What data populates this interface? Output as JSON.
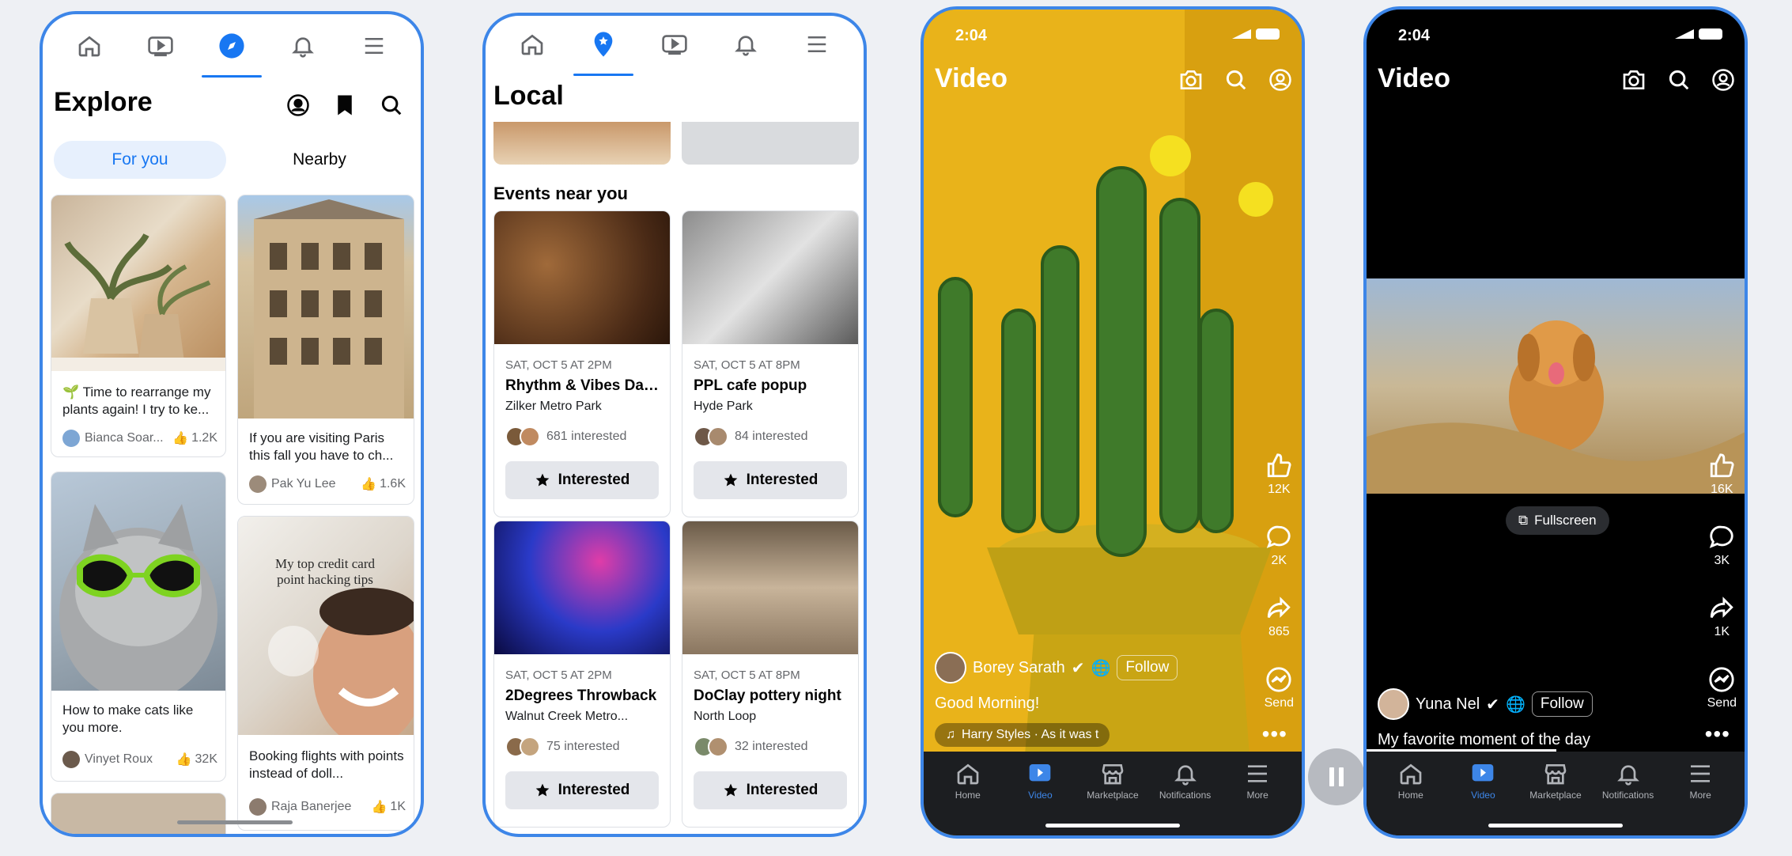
{
  "explore": {
    "title": "Explore",
    "tabs": [
      "For you",
      "Nearby"
    ],
    "cards": [
      {
        "text": "🌱 Time to rearrange my plants again! I try to ke...",
        "author": "Bianca Soar...",
        "likes": "1.2K"
      },
      {
        "text": "If you are visiting Paris this fall you have to ch...",
        "author": "Pak Yu Lee",
        "likes": "1.6K"
      },
      {
        "text": "How to make cats like you more.",
        "author": "Vinyet Roux",
        "likes": "32K"
      },
      {
        "text": "Booking flights with points instead of doll...",
        "author": "Raja Banerjee",
        "likes": "1K",
        "overlay": "My top credit card point hacking tips"
      }
    ]
  },
  "local": {
    "title": "Local",
    "section": "Events near you",
    "button_label": "Interested",
    "events": [
      {
        "date": "SAT, OCT 5 AT 2PM",
        "title": "Rhythm & Vibes Dan...",
        "place": "Zilker Metro Park",
        "interested": "681 interested"
      },
      {
        "date": "SAT, OCT 5 AT 8PM",
        "title": "PPL cafe popup",
        "place": "Hyde Park",
        "interested": "84 interested"
      },
      {
        "date": "SAT, OCT 5 AT 2PM",
        "title": "2Degrees Throwback",
        "place": "Walnut Creek Metro...",
        "interested": "75 interested"
      },
      {
        "date": "SAT, OCT 5 AT 8PM",
        "title": "DoClay pottery night",
        "place": "North Loop",
        "interested": "32 interested"
      }
    ]
  },
  "video1": {
    "time": "2:04",
    "title": "Video",
    "likes": "12K",
    "comments": "2K",
    "shares": "865",
    "send": "Send",
    "author": "Borey Sarath",
    "follow": "Follow",
    "caption": "Good Morning!",
    "music": "Harry Styles · As it was t"
  },
  "video2": {
    "time": "2:04",
    "title": "Video",
    "likes": "16K",
    "comments": "3K",
    "shares": "1K",
    "send": "Send",
    "fullscreen": "Fullscreen",
    "author": "Yuna Nel",
    "follow": "Follow",
    "caption": "My favorite moment of the day"
  },
  "bottom_nav": [
    "Home",
    "Video",
    "Marketplace",
    "Notifications",
    "More"
  ],
  "colors": {
    "accent": "#1877f2",
    "frame": "#3d86e8",
    "tab_active_bg": "#e7f0fd"
  }
}
